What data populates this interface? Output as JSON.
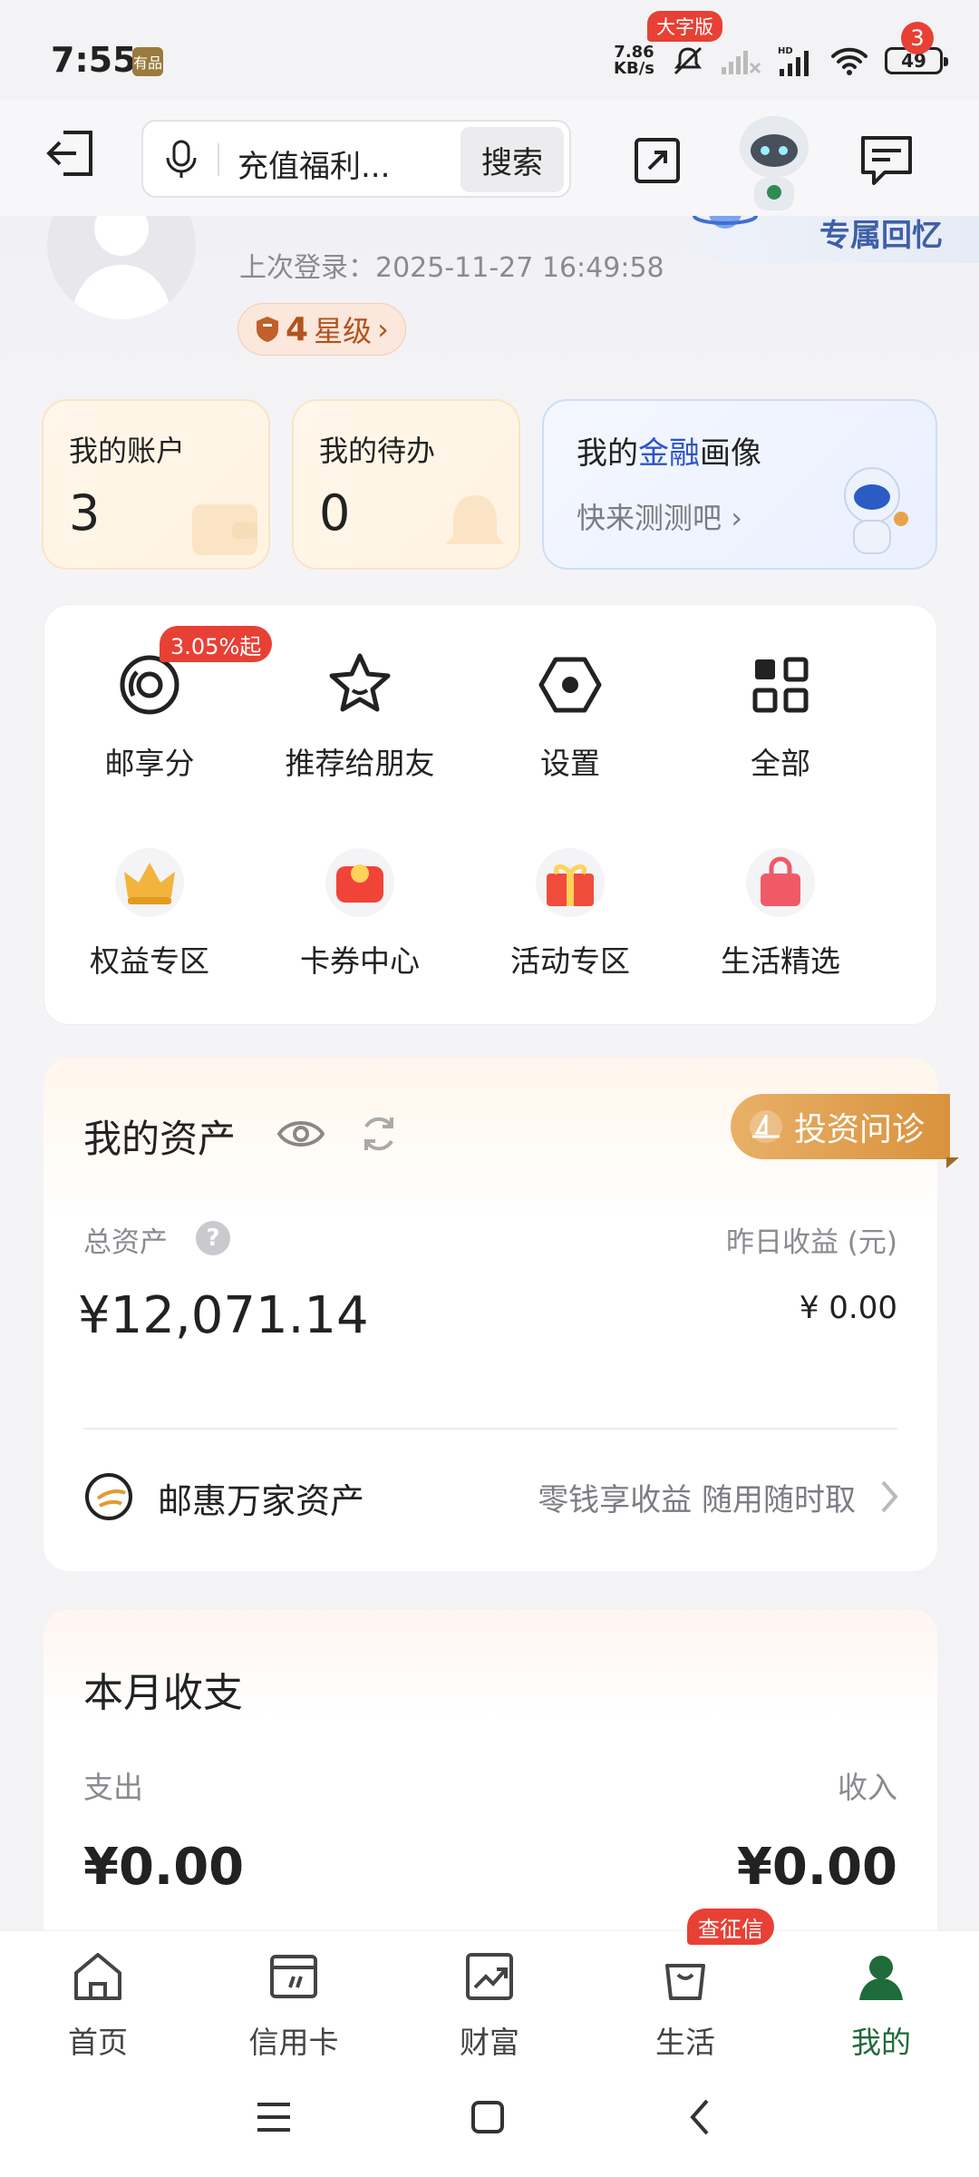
{
  "status_bar": {
    "time": "7:55",
    "app_tag": "有品",
    "net_speed_top": "7.86",
    "net_speed_bottom": "KB/s",
    "battery": "49"
  },
  "header": {
    "search_placeholder": "充值福利...",
    "search_button": "搜索",
    "big_font_badge": "大字版",
    "message_count": "3"
  },
  "profile": {
    "last_login": "上次登录：2025-11-27 16:49:58",
    "star_num": "4",
    "star_text": "星级",
    "memory_label": "专属回忆"
  },
  "quick_cards": {
    "accounts_label": "我的账户",
    "accounts_value": "3",
    "todo_label": "我的待办",
    "todo_value": "0",
    "finance_pre": "我的",
    "finance_hl": "金融",
    "finance_post": "画像",
    "finance_sub": "快来测测吧"
  },
  "services": [
    {
      "label": "邮享分",
      "badge": "3.05%起"
    },
    {
      "label": "推荐给朋友"
    },
    {
      "label": "设置"
    },
    {
      "label": "全部"
    },
    {
      "label": "权益专区"
    },
    {
      "label": "卡券中心"
    },
    {
      "label": "活动专区"
    },
    {
      "label": "生活精选"
    }
  ],
  "assets": {
    "title": "我的资产",
    "diagnosis_button": "投资问诊",
    "total_label": "总资产",
    "help_glyph": "?",
    "yesterday_label": "昨日收益 (元)",
    "total_value": "¥12,071.14",
    "yesterday_value": "¥  0.00",
    "product_name": "邮惠万家资产",
    "product_slogan": "零钱享收益 随用随时取"
  },
  "monthly": {
    "title": "本月收支",
    "out_label": "支出",
    "in_label": "收入",
    "out_value": "¥0.00",
    "in_value": "¥0.00"
  },
  "tabs": [
    {
      "label": "首页"
    },
    {
      "label": "信用卡"
    },
    {
      "label": "财富"
    },
    {
      "label": "生活",
      "badge": "查征信"
    },
    {
      "label": "我的",
      "active": true
    }
  ],
  "colors": {
    "accent_green": "#1f6b3a",
    "badge_red": "#e84035",
    "finance_blue": "#2c56c7",
    "gold": "#d9923c"
  }
}
